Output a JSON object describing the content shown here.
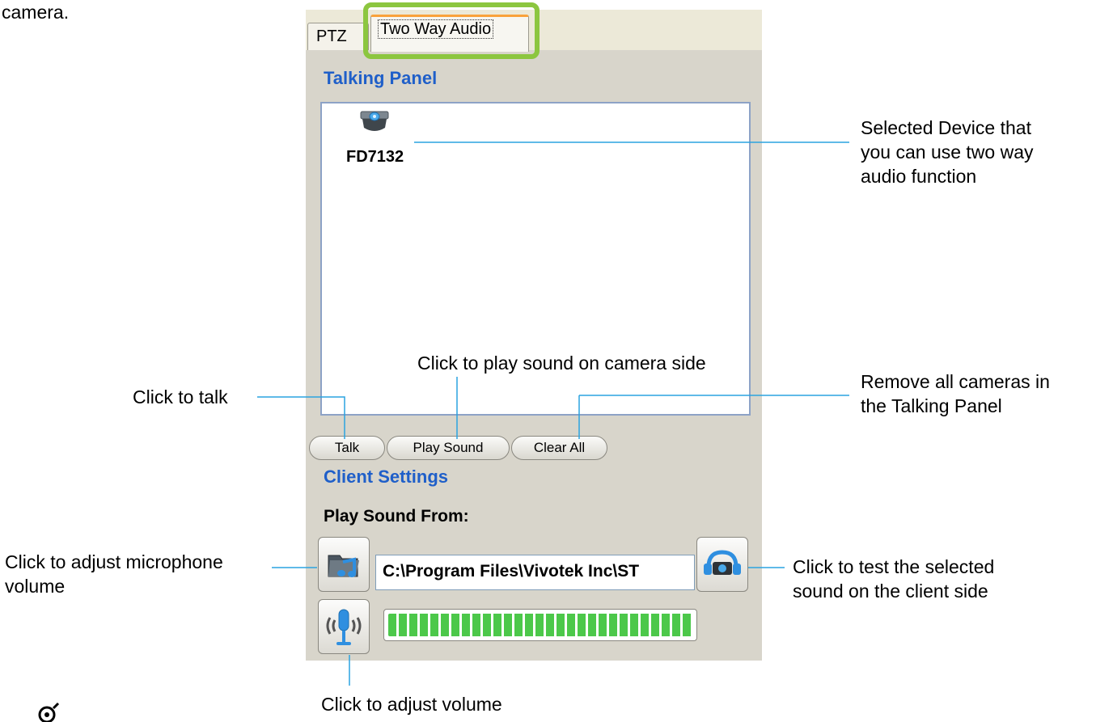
{
  "intro_text_fragment": "camera.",
  "tabs": [
    {
      "label": "PTZ",
      "selected": false
    },
    {
      "label": "Two Way Audio",
      "selected": true
    }
  ],
  "talking_panel": {
    "title": "Talking Panel",
    "device": {
      "name": "FD7132",
      "icon": "camera-icon"
    }
  },
  "buttons": {
    "talk": "Talk",
    "play_sound": "Play Sound",
    "clear_all": "Clear All"
  },
  "client_settings": {
    "title": "Client Settings",
    "play_sound_from_label": "Play Sound From:",
    "sound_path": "C:\\Program Files\\Vivotek Inc\\ST",
    "volume_level": 1.0
  },
  "callouts": {
    "selected_device": [
      "Selected Device that",
      "you can use two way",
      "audio function"
    ],
    "remove_all": [
      "Remove all cameras in",
      "the Talking Panel"
    ],
    "play_sound": "Click to play sound on camera side",
    "talk": "Click to talk",
    "mic_volume": [
      "Click to adjust microphone",
      "volume"
    ],
    "test_sound": [
      "Click to test the selected",
      "sound on the client side"
    ],
    "adjust_volume": "Click to adjust volume"
  },
  "colors": {
    "highlight": "#8cc63f",
    "section_title": "#1f5fc9",
    "callout_line": "#2aa3e0",
    "volume_fill": "#4cc84a"
  }
}
